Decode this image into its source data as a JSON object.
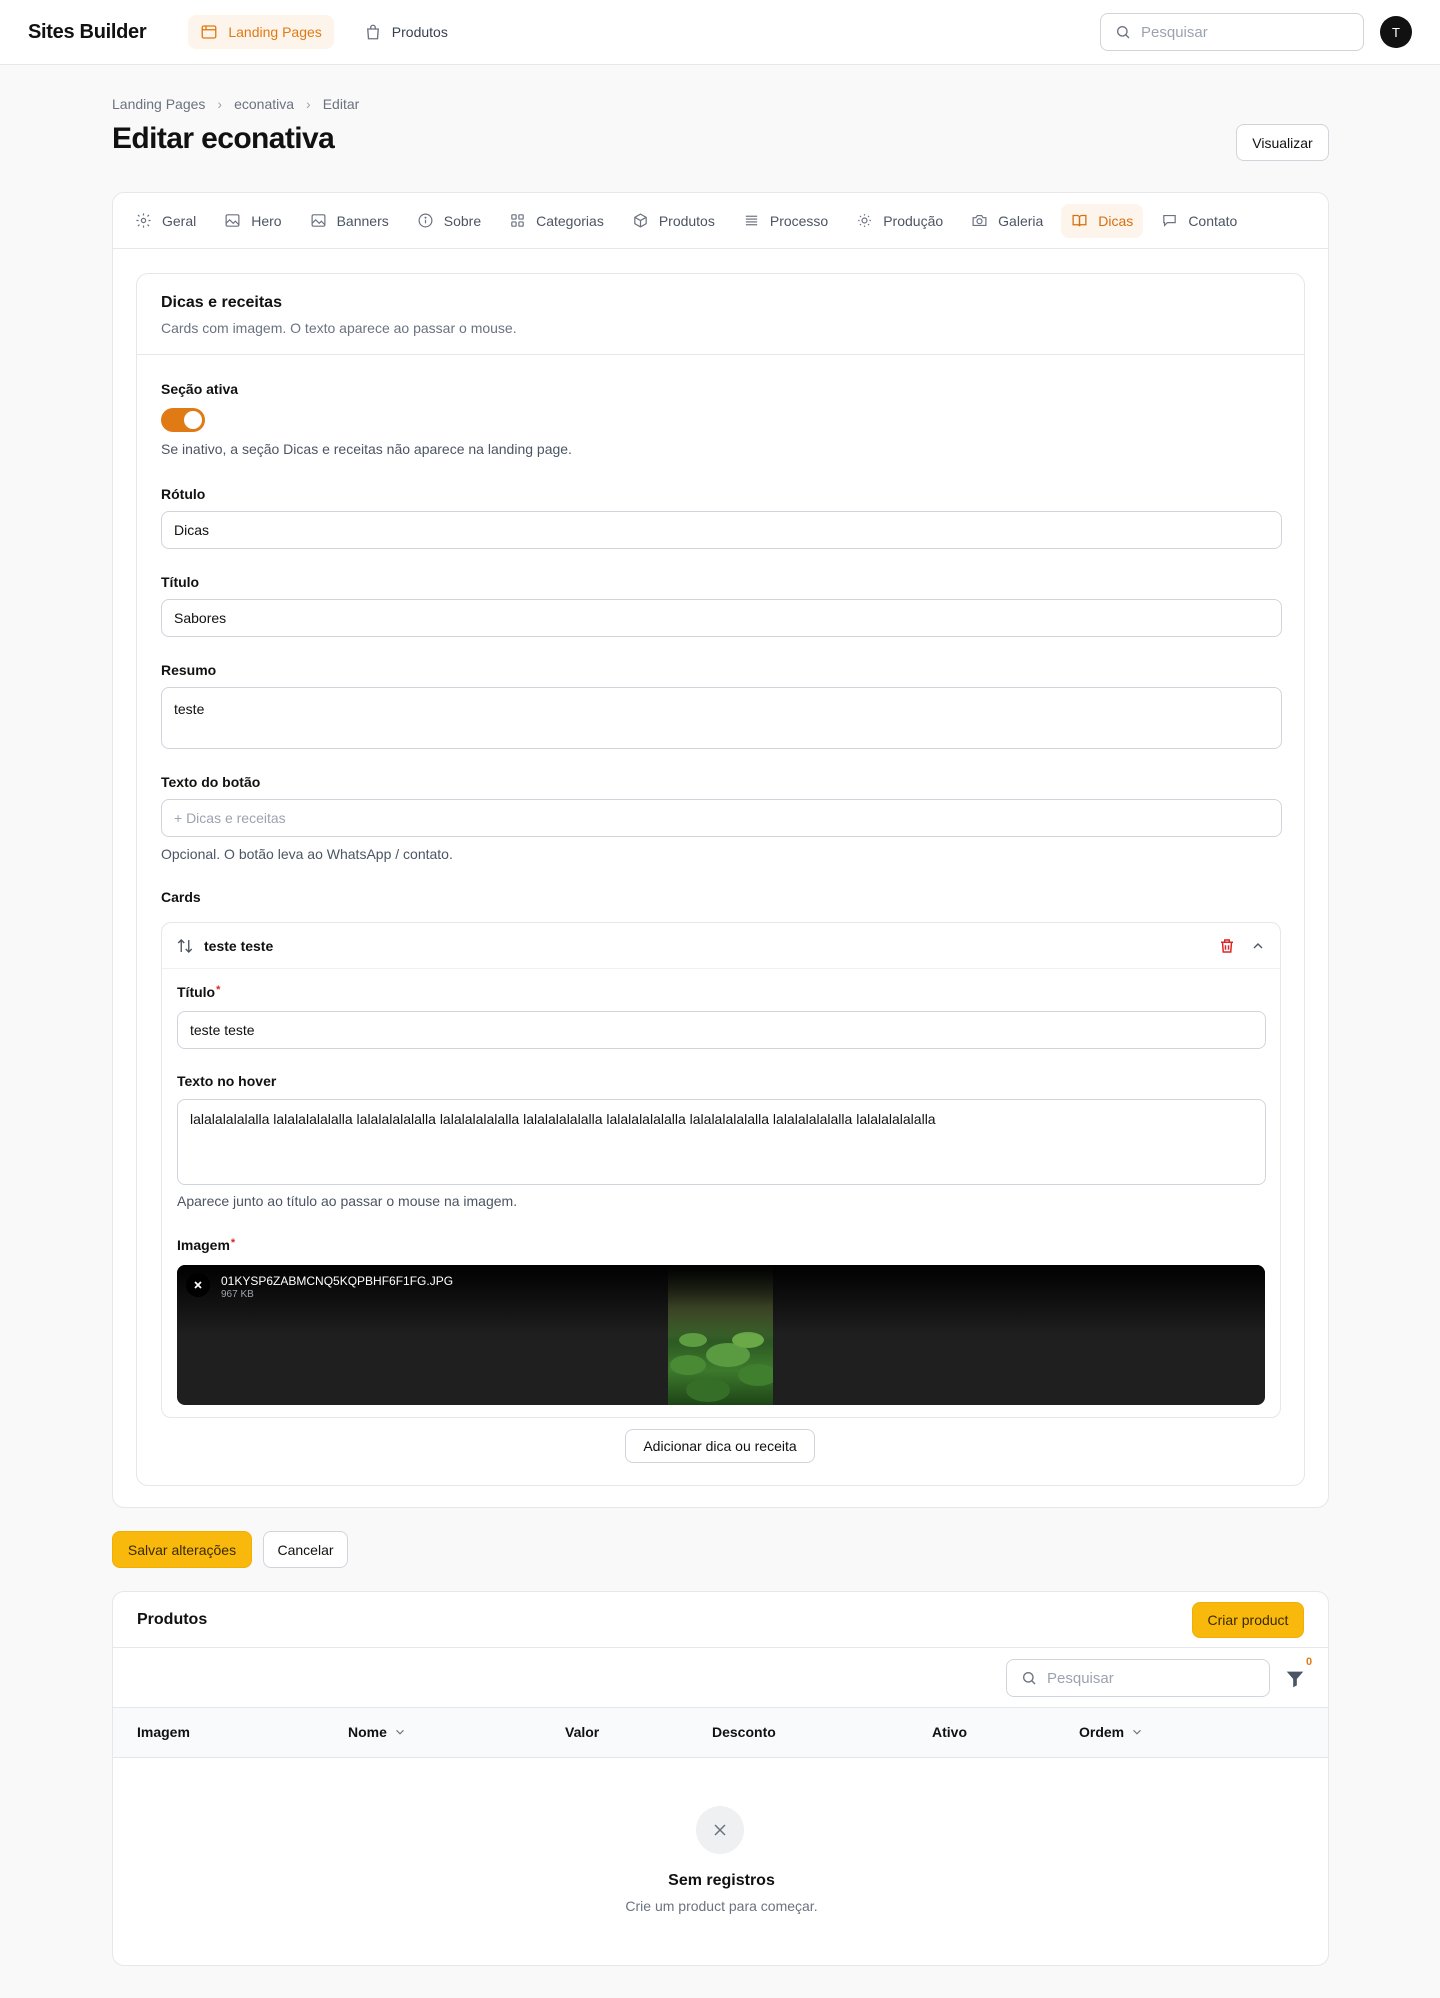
{
  "topbar": {
    "brand": "Sites Builder",
    "nav": [
      {
        "label": "Landing Pages"
      },
      {
        "label": "Produtos"
      }
    ],
    "search_placeholder": "Pesquisar",
    "avatar_initial": "T"
  },
  "breadcrumb": [
    "Landing Pages",
    "econativa",
    "Editar"
  ],
  "page_title": "Editar econativa",
  "view_button": "Visualizar",
  "tabs": [
    {
      "label": "Geral",
      "icon": "gear-icon"
    },
    {
      "label": "Hero",
      "icon": "image-icon"
    },
    {
      "label": "Banners",
      "icon": "image-icon"
    },
    {
      "label": "Sobre",
      "icon": "info-icon"
    },
    {
      "label": "Categorias",
      "icon": "grid-icon"
    },
    {
      "label": "Produtos",
      "icon": "cube-icon"
    },
    {
      "label": "Processo",
      "icon": "list-icon"
    },
    {
      "label": "Produção",
      "icon": "sun-icon"
    },
    {
      "label": "Galeria",
      "icon": "camera-icon"
    },
    {
      "label": "Dicas",
      "icon": "book-icon"
    },
    {
      "label": "Contato",
      "icon": "chat-icon"
    }
  ],
  "active_tab": "Dicas",
  "section": {
    "title": "Dicas e receitas",
    "description": "Cards com imagem. O texto aparece ao passar o mouse.",
    "active_label": "Seção ativa",
    "active_on": true,
    "active_help": "Se inativo, a seção Dicas e receitas não aparece na landing page.",
    "rotulo_label": "Rótulo",
    "rotulo_value": "Dicas",
    "titulo_label": "Título",
    "titulo_value": "Sabores",
    "resumo_label": "Resumo",
    "resumo_value": "teste",
    "botao_label": "Texto do botão",
    "botao_placeholder": "+ Dicas e receitas",
    "botao_help": "Opcional. O botão leva ao WhatsApp / contato.",
    "cards_label": "Cards",
    "card": {
      "header_title": "teste teste",
      "titulo_label": "Título",
      "titulo_value": "teste teste",
      "hover_label": "Texto no hover",
      "hover_value": "lalalalalalalla lalalalalalalla lalalalalalalla lalalalalalalla lalalalalalalla lalalalalalalla lalalalalalalla lalalalalalalla lalalalalalalla",
      "hover_help": "Aparece junto ao título ao passar o mouse na imagem.",
      "imagem_label": "Imagem",
      "file_name": "01KYSP6ZABMCNQ5KQPBHF6F1FG.JPG",
      "file_size": "967 KB"
    },
    "add_button": "Adicionar dica ou receita"
  },
  "actions": {
    "save": "Salvar alterações",
    "cancel": "Cancelar"
  },
  "products": {
    "title": "Produtos",
    "create_button": "Criar product",
    "search_placeholder": "Pesquisar",
    "filter_count": "0",
    "columns": [
      "Imagem",
      "Nome",
      "Valor",
      "Desconto",
      "Ativo",
      "Ordem"
    ],
    "empty_title": "Sem registros",
    "empty_desc": "Crie um product para começar."
  },
  "colors": {
    "accent": "#e07a14",
    "primary_button": "#f9b90c",
    "danger": "#dc2626"
  }
}
